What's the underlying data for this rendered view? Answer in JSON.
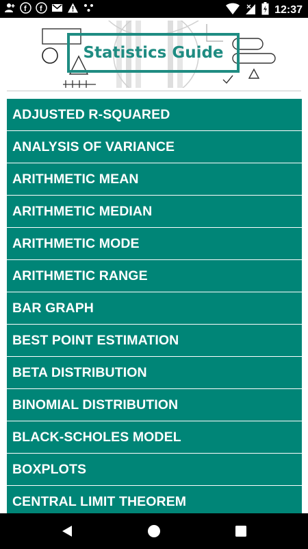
{
  "status_bar": {
    "time": "12:37",
    "left_icons": [
      "person-add-icon",
      "facebook-icon",
      "facebook-icon",
      "gmail-icon",
      "warning-icon",
      "dots-icon"
    ],
    "right_icons": [
      "wifi-icon",
      "signal-icon",
      "battery-icon"
    ]
  },
  "banner": {
    "title": "Statistics Guide"
  },
  "topics": [
    "ADJUSTED R-SQUARED",
    "ANALYSIS OF VARIANCE",
    "ARITHMETIC MEAN",
    "ARITHMETIC MEDIAN",
    "ARITHMETIC MODE",
    "ARITHMETIC RANGE",
    "BAR GRAPH",
    "BEST POINT ESTIMATION",
    "BETA DISTRIBUTION",
    "BINOMIAL DISTRIBUTION",
    "BLACK-SCHOLES MODEL",
    "BOXPLOTS",
    "CENTRAL LIMIT THEOREM"
  ],
  "colors": {
    "list_item_bg": "#008577",
    "accent": "#1f8c82"
  },
  "nav": {
    "buttons": [
      "back-icon",
      "home-icon",
      "recents-icon"
    ]
  }
}
